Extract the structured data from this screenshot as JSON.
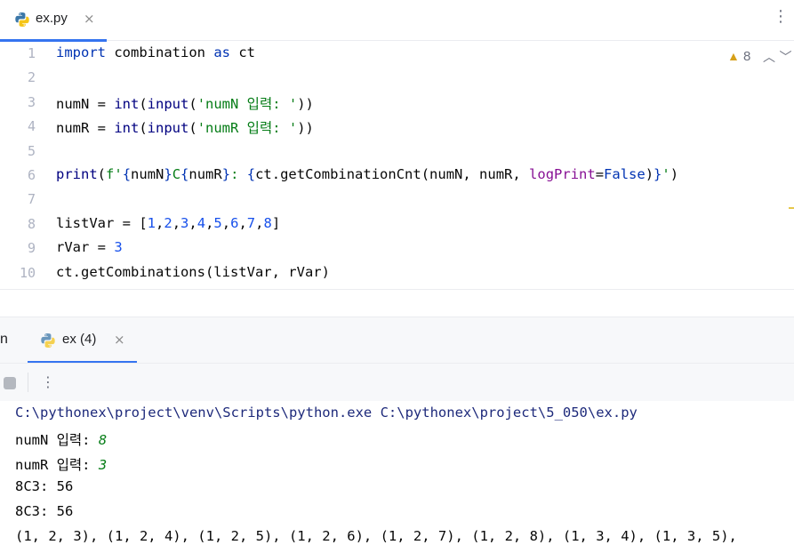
{
  "editor_tab": {
    "filename": "ex.py",
    "close": "×"
  },
  "more_icon": "⋮",
  "inspections": {
    "icon": "warning-triangle-icon",
    "count": "8"
  },
  "code_lines": [
    {
      "num": "1",
      "html_tokens": [
        [
          "kw",
          "import"
        ],
        [
          "",
          " combination "
        ],
        [
          "kw",
          "as"
        ],
        [
          "",
          " ct"
        ]
      ]
    },
    {
      "num": "2",
      "html_tokens": []
    },
    {
      "num": "3",
      "html_tokens": [
        [
          "",
          "numN = "
        ],
        [
          "builtin",
          "int"
        ],
        [
          "",
          "("
        ],
        [
          "builtin",
          "input"
        ],
        [
          "",
          "("
        ],
        [
          "str",
          "'numN 입력: '"
        ],
        [
          "",
          "))"
        ]
      ]
    },
    {
      "num": "4",
      "html_tokens": [
        [
          "",
          "numR = "
        ],
        [
          "builtin",
          "int"
        ],
        [
          "",
          "("
        ],
        [
          "builtin",
          "input"
        ],
        [
          "",
          "("
        ],
        [
          "str",
          "'numR 입력: '"
        ],
        [
          "",
          "))"
        ]
      ]
    },
    {
      "num": "5",
      "html_tokens": []
    },
    {
      "num": "6",
      "html_tokens": [
        [
          "builtin",
          "print"
        ],
        [
          "",
          "("
        ],
        [
          "str",
          "f'"
        ],
        [
          "kw",
          "{"
        ],
        [
          "",
          "numN"
        ],
        [
          "kw",
          "}"
        ],
        [
          "str",
          "C"
        ],
        [
          "kw",
          "{"
        ],
        [
          "",
          "numR"
        ],
        [
          "kw",
          "}"
        ],
        [
          "str",
          ": "
        ],
        [
          "kw",
          "{"
        ],
        [
          "",
          "ct.getCombinationCnt(numN, numR, "
        ],
        [
          "param",
          "logPrint"
        ],
        [
          "",
          "="
        ],
        [
          "kw",
          "False"
        ],
        [
          "",
          ")"
        ],
        [
          "kw",
          "}"
        ],
        [
          "str",
          "'"
        ],
        [
          "",
          ")"
        ]
      ]
    },
    {
      "num": "7",
      "html_tokens": []
    },
    {
      "num": "8",
      "html_tokens": [
        [
          "",
          "listVar = ["
        ],
        [
          "num",
          "1"
        ],
        [
          "",
          ","
        ],
        [
          "num",
          "2"
        ],
        [
          "",
          ","
        ],
        [
          "num",
          "3"
        ],
        [
          "",
          ","
        ],
        [
          "num",
          "4"
        ],
        [
          "",
          ","
        ],
        [
          "num",
          "5"
        ],
        [
          "",
          ","
        ],
        [
          "num",
          "6"
        ],
        [
          "",
          ","
        ],
        [
          "num",
          "7"
        ],
        [
          "",
          ","
        ],
        [
          "num",
          "8"
        ],
        [
          "",
          "]"
        ]
      ]
    },
    {
      "num": "9",
      "html_tokens": [
        [
          "",
          "rVar = "
        ],
        [
          "num",
          "3"
        ]
      ]
    },
    {
      "num": "10",
      "html_tokens": [
        [
          "",
          "ct.getCombinations(listVar, rVar)"
        ]
      ]
    }
  ],
  "run_panel": {
    "left_cut_label": "n",
    "tab_label": "ex (4)",
    "close": "×"
  },
  "toolbar": {
    "more": "⋮"
  },
  "console": {
    "command": "C:\\pythonex\\project\\venv\\Scripts\\python.exe C:\\pythonex\\project\\5_050\\ex.py",
    "prompt1": "numN 입력: ",
    "input1": "8",
    "prompt2": "numR 입력: ",
    "input2": "3",
    "out1": "8C3: 56",
    "out2": "8C3: 56",
    "out3": "(1, 2, 3), (1, 2, 4), (1, 2, 5), (1, 2, 6), (1, 2, 7), (1, 2, 8), (1, 3, 4), (1, 3, 5),"
  }
}
